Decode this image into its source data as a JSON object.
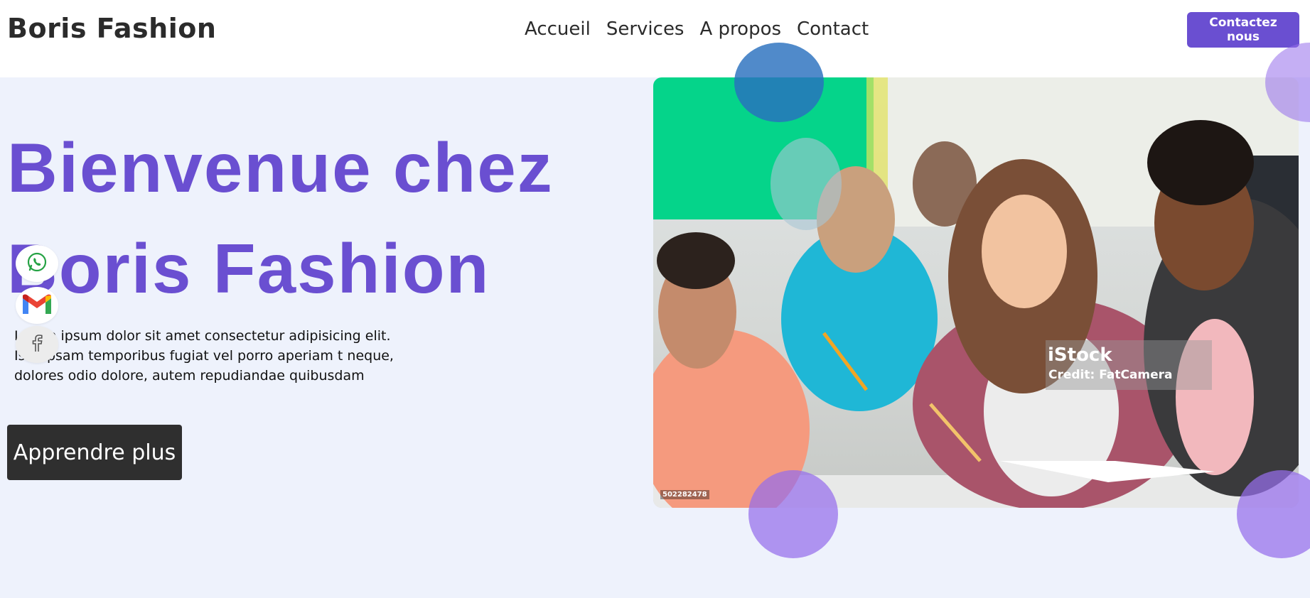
{
  "header": {
    "brand": "Boris Fashion",
    "nav": [
      "Accueil",
      "Services",
      "A propos",
      "Contact"
    ],
    "cta": "Contactez nous"
  },
  "hero": {
    "title_line1": "Bienvenue chez",
    "title_line2": "Boris Fashion",
    "text": "Lorem ipsum dolor sit amet consectetur adipisicing elit. Iste ipsam temporibus fugiat vel porro aperiam t neque, dolores odio dolore, autem repudiandae quibusdam",
    "button": "Apprendre plus"
  },
  "social": [
    "whatsapp-icon",
    "gmail-icon",
    "facebook-icon"
  ],
  "photo": {
    "watermark_logo": "iStock",
    "watermark_credit": "Credit: FatCamera",
    "stock_id": "502282478"
  },
  "colors": {
    "accent": "#6a4fd1",
    "page_bg": "#eef2fc",
    "dark_button": "#2f2f2f",
    "decor_circle": "#9b6ef0"
  }
}
